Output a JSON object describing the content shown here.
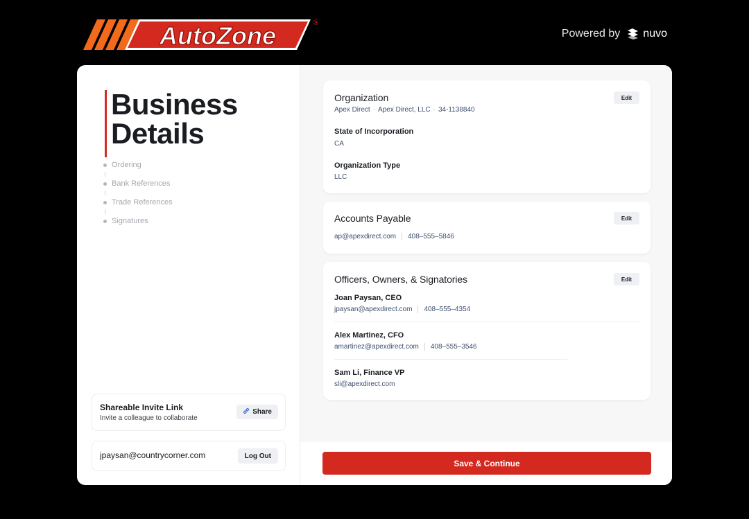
{
  "brand": {
    "name": "AutoZone",
    "registered": "®",
    "powered_by": "Powered by",
    "partner": "nuvo",
    "colors": {
      "orange": "#f26b1d",
      "red": "#d4291f"
    }
  },
  "page": {
    "title_line1": "Business",
    "title_line2": "Details"
  },
  "steps": [
    {
      "label": "Ordering"
    },
    {
      "label": "Bank References"
    },
    {
      "label": "Trade References"
    },
    {
      "label": "Signatures"
    }
  ],
  "invite": {
    "title": "Shareable Invite Link",
    "subtitle": "Invite a colleague to collaborate",
    "button": "Share",
    "icon": "link-icon"
  },
  "account": {
    "email": "jpaysan@countrycorner.com",
    "logout": "Log Out"
  },
  "organization": {
    "heading": "Organization",
    "edit": "Edit",
    "name": "Apex Direct",
    "legal_name": "Apex Direct, LLC",
    "ein": "34-1138840",
    "sep": "·",
    "state_label": "State of Incorporation",
    "state_value": "CA",
    "type_label": "Organization Type",
    "type_value": "LLC"
  },
  "payable": {
    "heading": "Accounts Payable",
    "edit": "Edit",
    "email": "ap@apexdirect.com",
    "phone": "408–555–5846"
  },
  "officers": {
    "heading": "Officers, Owners, & Signatories",
    "edit": "Edit",
    "people": [
      {
        "name": "Joan Paysan, CEO",
        "email": "jpaysan@apexdirect.com",
        "phone": "408–555–4354"
      },
      {
        "name": "Alex Martinez, CFO",
        "email": "amartinez@apexdirect.com",
        "phone": "408–555–3546"
      },
      {
        "name": "Sam Li, Finance VP",
        "email": "sli@apexdirect.com",
        "phone": ""
      }
    ]
  },
  "footer": {
    "save": "Save & Continue"
  }
}
